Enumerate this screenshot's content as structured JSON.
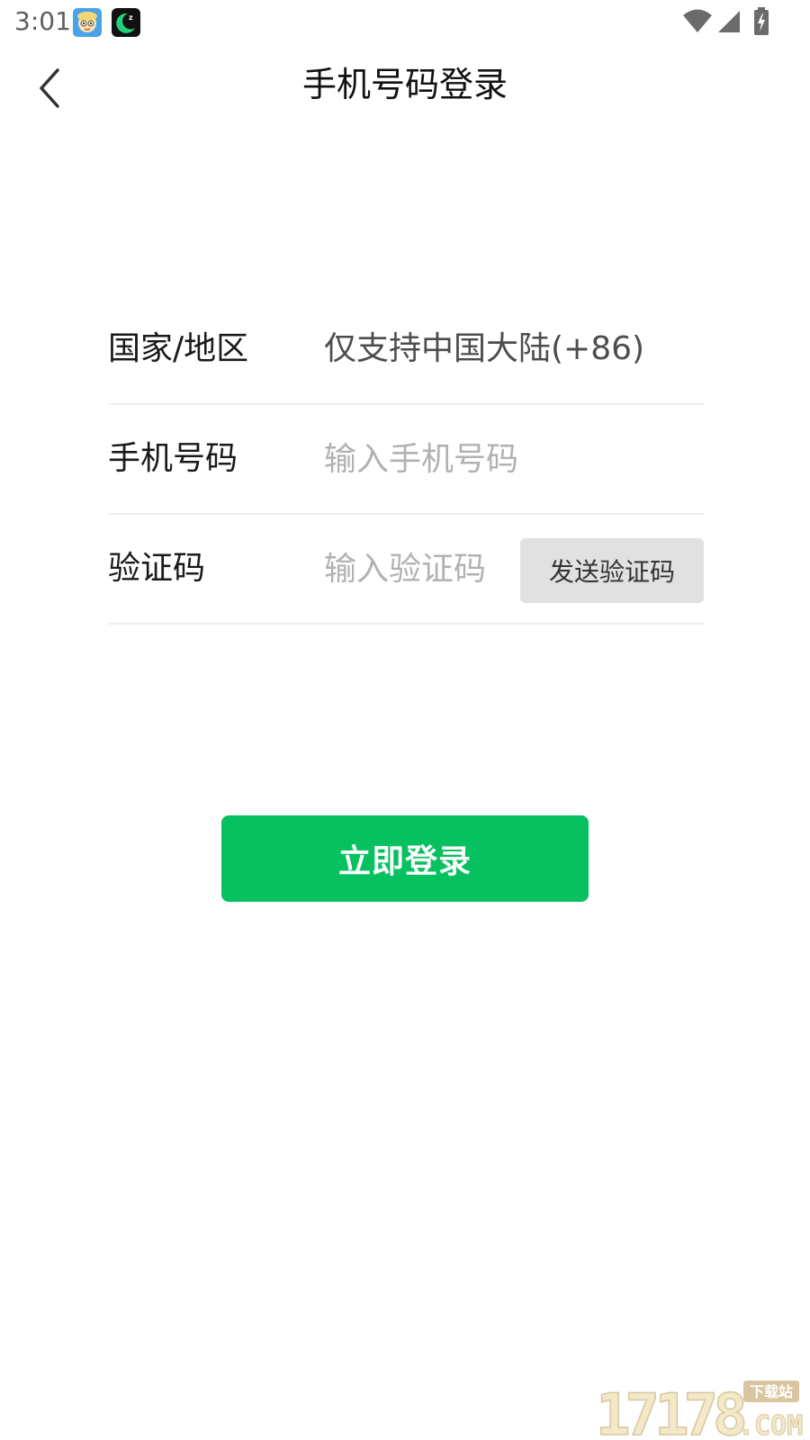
{
  "status_bar": {
    "time": "3:01",
    "icons": [
      "avatar-app-icon",
      "moon-app-icon",
      "wifi-icon",
      "signal-icon",
      "battery-charging-icon"
    ]
  },
  "header": {
    "title": "手机号码登录",
    "back_icon": "chevron-left-icon"
  },
  "form": {
    "region": {
      "label": "国家/地区",
      "value": "仅支持中国大陆(+86)"
    },
    "phone": {
      "label": "手机号码",
      "value": "",
      "placeholder": "输入手机号码"
    },
    "code": {
      "label": "验证码",
      "value": "",
      "placeholder": "输入验证码",
      "send_label": "发送验证码"
    }
  },
  "login_button": {
    "label": "立即登录"
  },
  "colors": {
    "primary": "#07c160",
    "send_button_bg": "#e1e1e1",
    "divider": "#eeeeee",
    "placeholder": "#b2b2b2"
  },
  "watermark": {
    "text": "17178",
    "suffix": ".COM",
    "tag": "下载站"
  }
}
